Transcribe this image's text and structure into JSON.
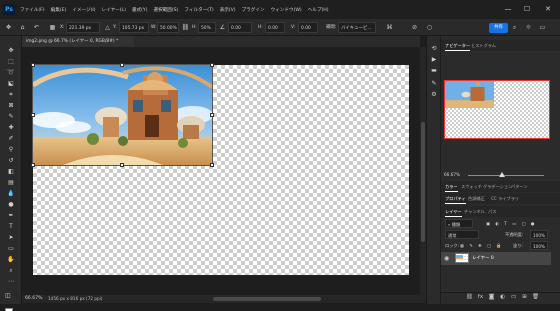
{
  "app": {
    "logo": "Ps"
  },
  "menu": [
    "ファイル(F)",
    "編集(E)",
    "イメージ(I)",
    "レイヤー(L)",
    "書式(Y)",
    "選択範囲(S)",
    "フィルター(T)",
    "表示(V)",
    "プラグイン",
    "ウィンドウ(W)",
    "ヘルプ(H)"
  ],
  "window_controls": {
    "minimize": "—",
    "maximize": "☐",
    "close": "✕"
  },
  "options": {
    "x_label": "X:",
    "x_value": "221.39 px",
    "y_label": "Y:",
    "y_value": "105.73 px",
    "w_label": "W:",
    "w_value": "50.00%",
    "h_label": "H:",
    "h_value": "50%",
    "angle_value": "0.00",
    "hskew_label": "H:",
    "hskew_value": "0.00",
    "vskew_label": "V:",
    "vskew_value": "0.00",
    "interp_label": "補間:",
    "interp_value": "バイキュービ...",
    "share_label": "共有"
  },
  "document": {
    "tab_title": "img2.png @ 66.7% (レイヤー 0, RGB/8#) *"
  },
  "status": {
    "zoom": "66.67%",
    "dims": "1456 px x 816 px (72 ppi)"
  },
  "panels": {
    "nav_tabs": [
      "ナビゲーター",
      "ヒストグラム"
    ],
    "nav_zoom": "66.67%",
    "color_tabs": [
      "カラー",
      "スウォッチ",
      "グラデーション",
      "パターン"
    ],
    "props_tabs": [
      "プロパティ",
      "色調補正",
      "CC ライブラリ"
    ],
    "layer_tabs": [
      "レイヤー",
      "チャンネル",
      "パス"
    ],
    "kind_label": "種類",
    "blend_mode": "通常",
    "opacity_label": "不透明度:",
    "opacity_value": "100%",
    "lock_label": "ロック:",
    "fill_label": "塗り:",
    "fill_value": "100%",
    "layer_name": "レイヤー 0"
  },
  "colors": {
    "accent": "#1473e6",
    "panel": "#2b2b2b",
    "selection": "#ff3333"
  }
}
